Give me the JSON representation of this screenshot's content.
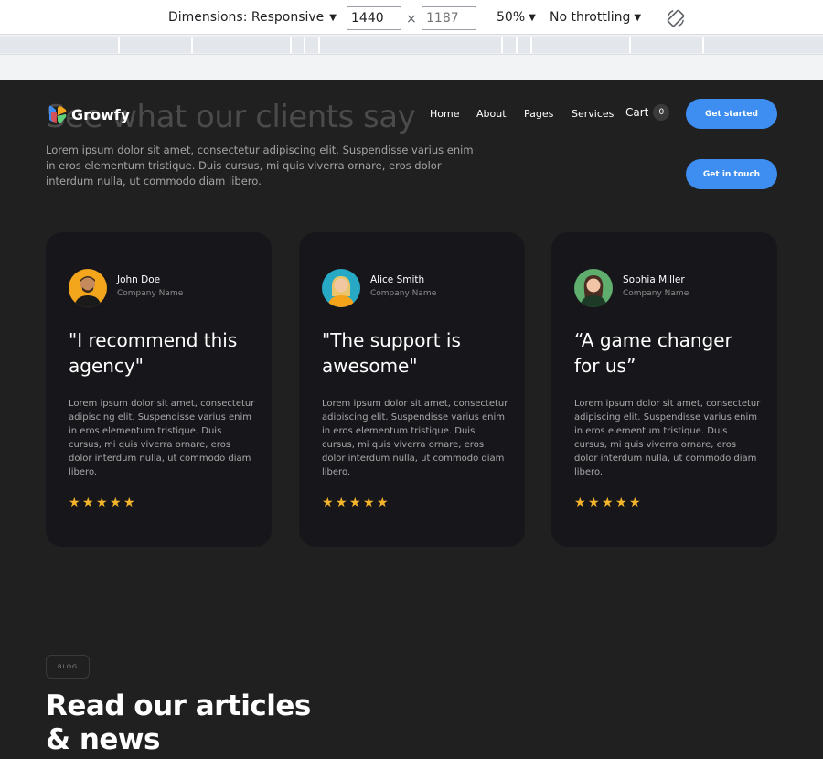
{
  "devtools": {
    "dimensions_label": "Dimensions: Responsive",
    "width_value": "1440",
    "height_placeholder": "1187",
    "times": "×",
    "zoom": "50%",
    "throttling": "No throttling",
    "rotate_icon": "rotate-icon"
  },
  "nav": {
    "logo_text": "Growfy",
    "links": [
      "Home",
      "About",
      "Pages",
      "Services"
    ],
    "cart_label": "Cart",
    "cart_count": "0",
    "get_started": "Get started",
    "get_in_touch": "Get in touch"
  },
  "section": {
    "title": "See what our clients say",
    "intro": "Lorem ipsum dolor sit amet, consectetur adipiscing elit. Suspendisse varius enim in eros elementum tristique. Duis cursus, mi quis viverra ornare, eros dolor interdum nulla, ut commodo diam libero."
  },
  "testimonials": [
    {
      "name": "John Doe",
      "company": "Company Name",
      "quote": "\"I recommend this agency\"",
      "text": "Lorem ipsum dolor sit amet, consectetur adipiscing elit. Suspendisse varius enim in eros elementum tristique. Duis cursus, mi quis viverra ornare, eros dolor interdum nulla, ut commodo diam libero.",
      "rating": 5,
      "avatar_bg": "#f3a51b"
    },
    {
      "name": "Alice Smith",
      "company": "Company Name",
      "quote": "\"The support is awesome\"",
      "text": "Lorem ipsum dolor sit amet, consectetur adipiscing elit. Suspendisse varius enim in eros elementum tristique. Duis cursus, mi quis viverra ornare, eros dolor interdum nulla, ut commodo diam libero.",
      "rating": 5,
      "avatar_bg": "#27a9c6"
    },
    {
      "name": "Sophia Miller",
      "company": "Company Name",
      "quote": "“A game changer for us”",
      "text": "Lorem ipsum dolor sit amet, consectetur adipiscing elit. Suspendisse varius enim in eros elementum tristique. Duis cursus, mi quis viverra ornare, eros dolor interdum nulla, ut commodo diam libero.",
      "rating": 5,
      "avatar_bg": "#5fae6e"
    }
  ],
  "blog": {
    "tag": "BLOG",
    "title": "Read our articles & news"
  },
  "colors": {
    "accent": "#3d8ef0",
    "star": "#f5b52b",
    "page_bg": "#202020",
    "card_bg": "#17161a"
  }
}
